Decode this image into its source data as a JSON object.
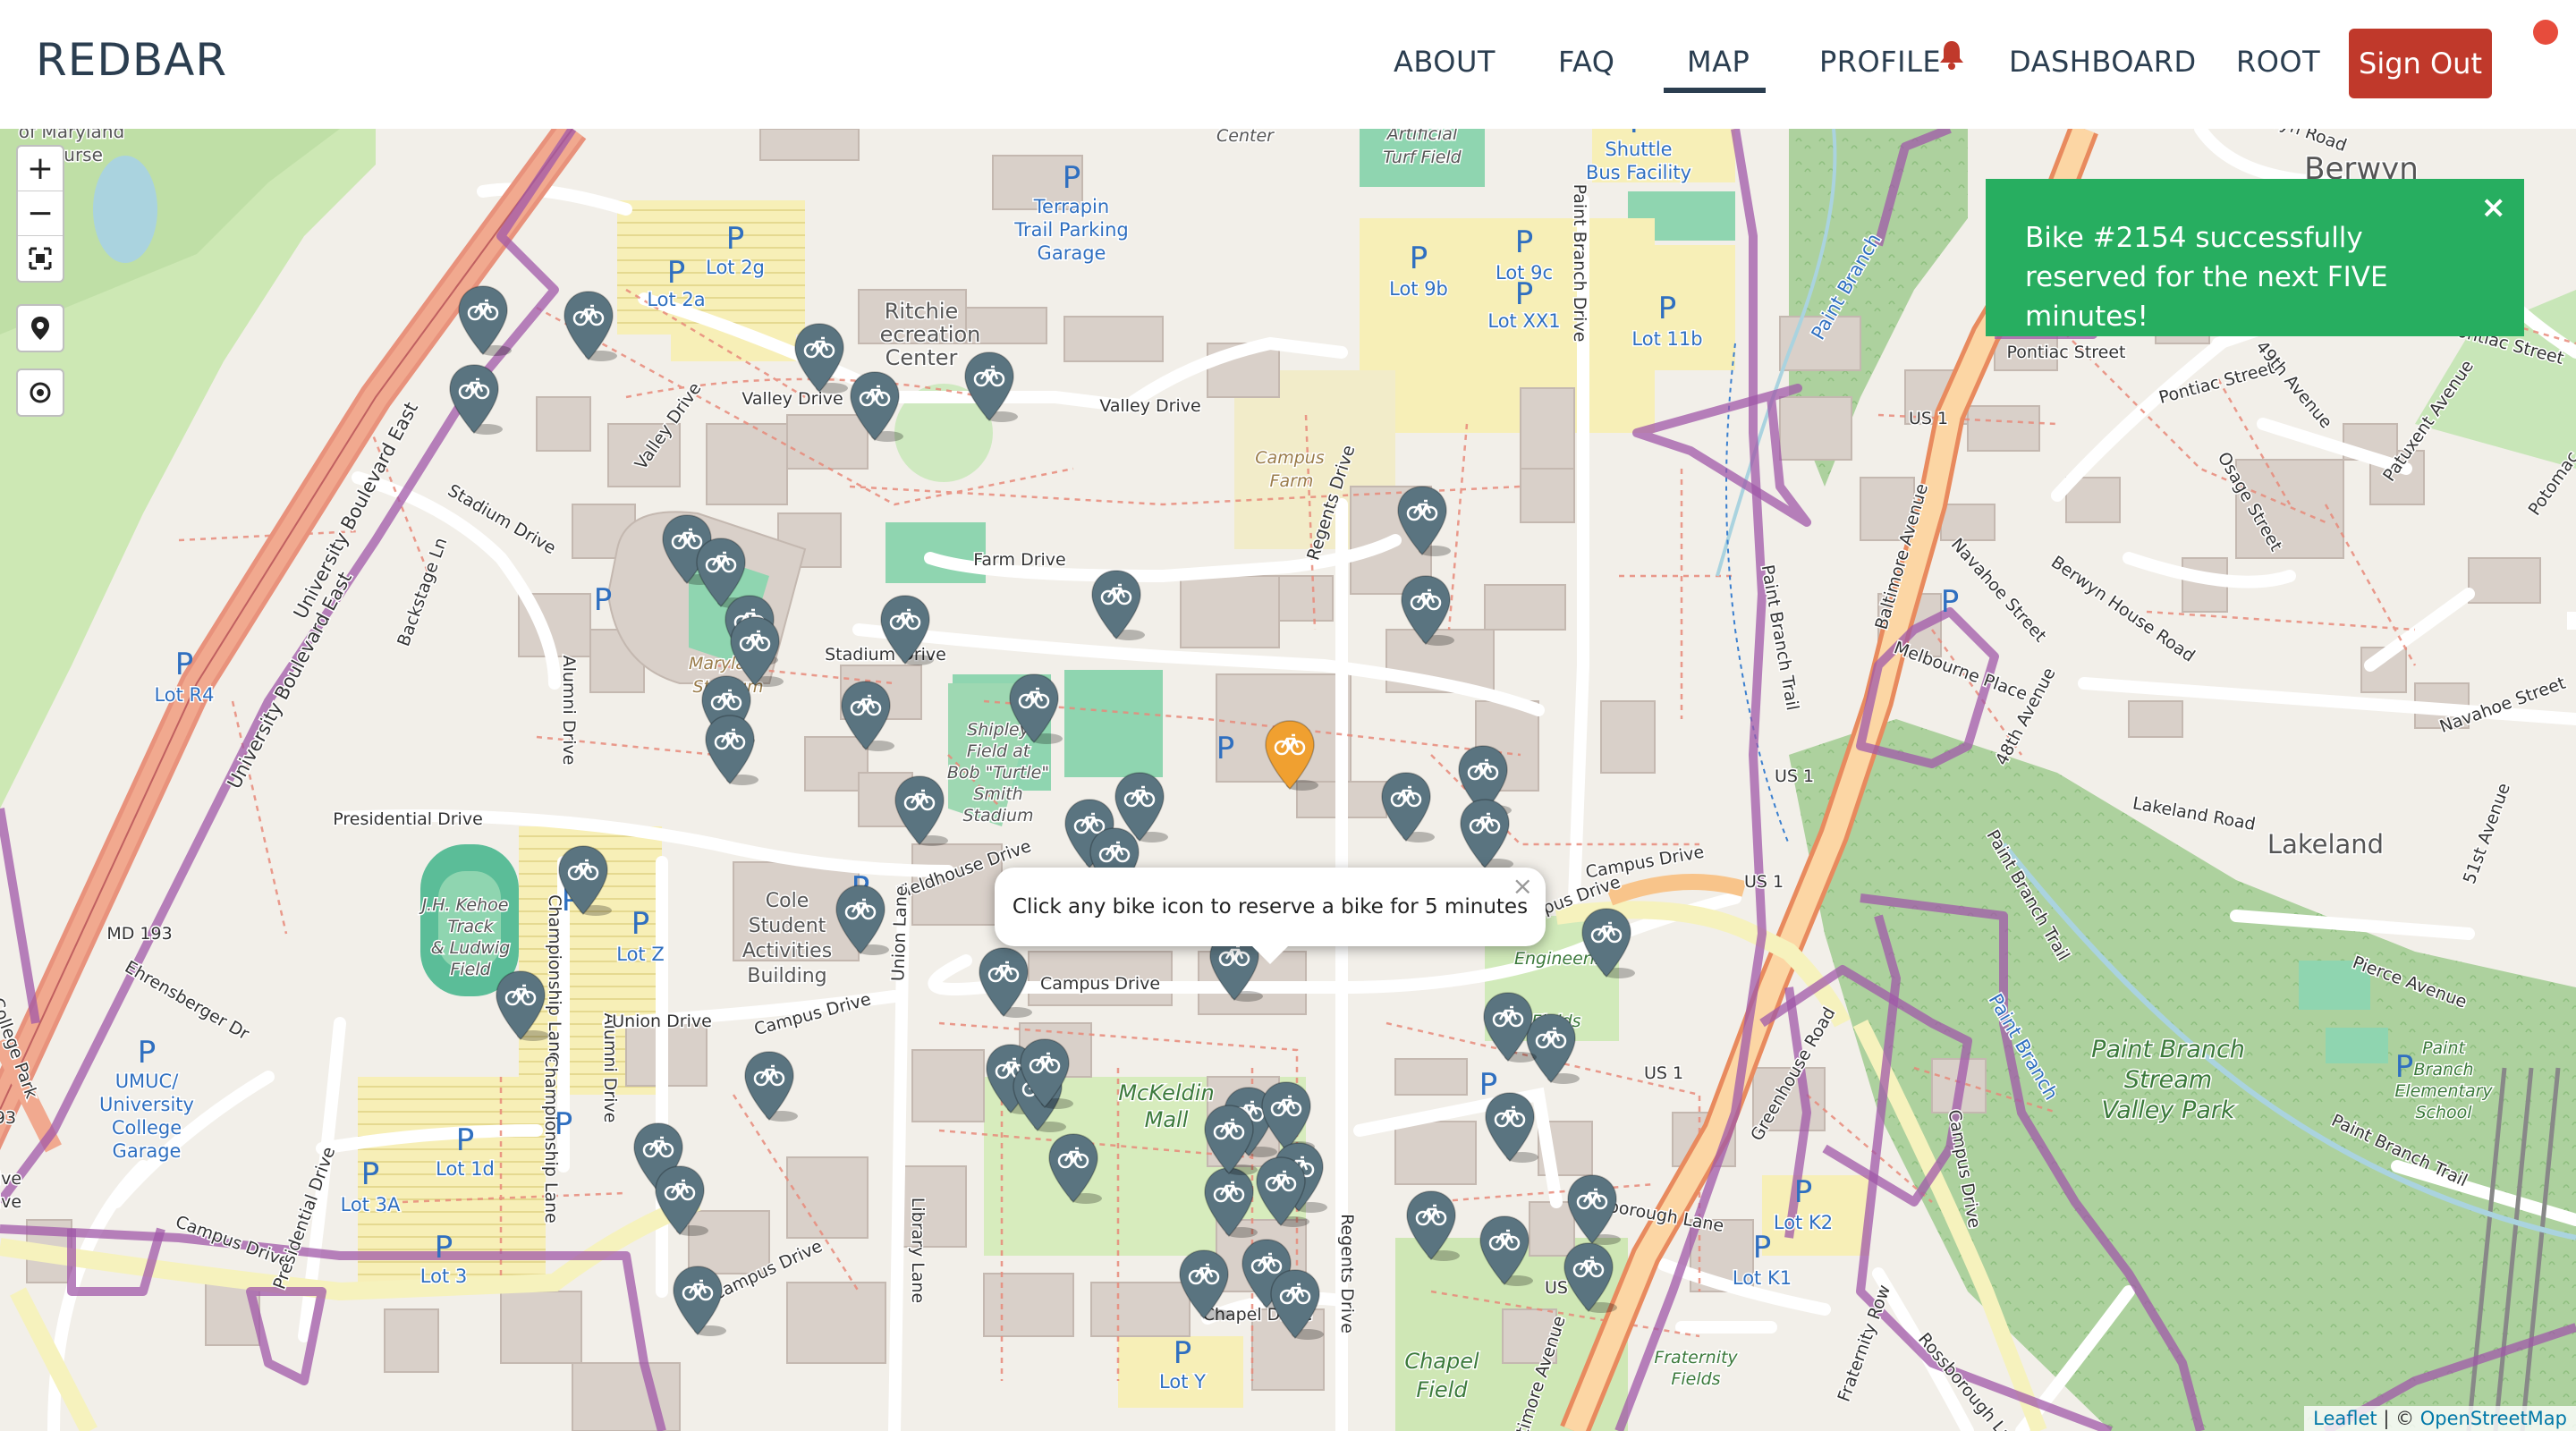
{
  "brand": "REDBAR",
  "nav": {
    "about": "ABOUT",
    "faq": "FAQ",
    "map": "MAP",
    "profile": "PROFILE",
    "dashboard": "DASHBOARD",
    "root": "ROOT",
    "sign_out": "Sign Out",
    "active": "MAP"
  },
  "colors": {
    "brand_text": "#2b3e50",
    "sign_out_bg": "#c0392b",
    "toast_bg": "#27ae60",
    "bike_marker": "#5a7480",
    "selected_marker": "#f0a030",
    "boundary": "#a058a8"
  },
  "map": {
    "controls": {
      "zoom_in": "+",
      "zoom_out": "−",
      "fullscreen_icon": "fullscreen-icon",
      "locate_icon": "map-pin-icon",
      "target_icon": "target-icon"
    },
    "toast": {
      "message": "Bike #2154 successfully reserved for the next FIVE minutes!",
      "close": "×"
    },
    "popup": {
      "message": "Click any bike icon to reserve a bike for 5 minutes",
      "close": "×"
    },
    "attribution": {
      "leaflet": "Leaflet",
      "separator": " | © ",
      "osm": "OpenStreetMap"
    },
    "labels": {
      "terrapin": "Terrapin",
      "trail_parking": "Trail Parking",
      "garage": "Garage",
      "center": "Center",
      "artificial": "Artificial",
      "turf_field": "Turf Field",
      "shuttle": "Shuttle",
      "bus_facility": "Bus Facility",
      "lot_2g": "Lot 2g",
      "lot_2a": "Lot 2a",
      "lot_9b": "Lot 9b",
      "lot_9c": "Lot 9c",
      "lot_xx1": "Lot XX1",
      "lot_11b": "Lot 11b",
      "ritchie": "Ritchie",
      "recreation": "ecreation",
      "center2": "Center",
      "valley_drive": "Valley Drive",
      "valley_drive2": "Valley Drive",
      "campus_farm": "Campus",
      "farm": "Farm",
      "farm_drive": "Farm Drive",
      "stadium_drive": "Stadium Drive",
      "stadium_drive2": "Stadium Drive",
      "regents_drive": "Regents Drive",
      "regents_drive2": "Regents Drive",
      "paint_branch_drive": "Paint Branch Drive",
      "univ_blvd_east": "University Boulevard East",
      "univ_blvd_east2": "University Boulevard East",
      "backstage_ln": "Backstage Ln",
      "lot_r4": "Lot R4",
      "alumni_drive": "Alumni Drive",
      "alumni_drive2": "Alumni Drive",
      "maryland_stadium": "Maryland",
      "stadium": "Stadium",
      "shipley": "Shipley",
      "field_at": "Field at",
      "bob_turtle": "Bob \"Turtle\"",
      "smith": "Smith",
      "stadium2": "Stadium",
      "presidential_drive": "Presidential Drive",
      "presidential_drive2": "Presidential Drive",
      "fieldhouse_drive": "Fieldhouse Drive",
      "jh_kehoe": "J.H. Kehoe",
      "track": "Track",
      "ludwig": "& Ludwig",
      "field": "Field",
      "championship_lane": "Championship Lane",
      "championship_lane2": "Championship Lane",
      "lot_z": "Lot Z",
      "cole": "Cole",
      "student": "Student",
      "activities": "Activities",
      "building": "Building",
      "union_lane": "Union Lane",
      "union_drive": "Union Drive",
      "campus_drive": "Campus Drive",
      "campus_drive2": "Campus Drive",
      "campus_drive3": "Campus Drive",
      "campus_drive4": "Campus Drive",
      "campus_drive5": "Campus Drive",
      "campus_drive6": "Campus Drive",
      "campus_drive7": "Campus Drive",
      "md_193": "MD 193",
      "ehrensberger": "Ehrensberger Dr",
      "umuc": "UMUC/",
      "university": "University",
      "college": "College",
      "garage2": "Garage",
      "lot_1d": "Lot 1d",
      "lot_3a": "Lot 3A",
      "lot_3": "Lot 3",
      "mckeldin": "McKeldin",
      "mall": "Mall",
      "library_lane": "Library Lane",
      "chapel_drive": "Chapel Drive",
      "chapel": "Chapel",
      "field2": "Field",
      "lot_y": "Lot Y",
      "engineering": "Engineering",
      "fields": "Fields",
      "fraternity": "Fraternity",
      "fields2": "Fields",
      "fraternity_row": "Fraternity Row",
      "lot_k2": "Lot K2",
      "lot_k1": "Lot K1",
      "rossborough_lane": "Rossborough Lane",
      "rossborough_lane2": "Rossborough Lane",
      "greenhouse_road": "Greenhouse Road",
      "us1": "US 1",
      "us1b": "US 1",
      "us1c": "US 1",
      "us1d": "US 1",
      "us1e": "US 1",
      "us1f": "US",
      "baltimore_avenue": "Baltimore Avenue",
      "baltimore_avenue2": "Baltimore Avenue",
      "navahoe_street": "Navahoe Street",
      "navahoe_street2": "Navahoe Street",
      "melbourne_place": "Melbourne Place",
      "berwyn_house_road": "Berwyn House Road",
      "berwyn_road": "Berwyn Road",
      "berwyn": "Berwyn",
      "pontiac_street": "Pontiac Street",
      "pontiac_street2": "Pontiac Street",
      "pontiac_street3": "Pontiac Street",
      "osage_street": "Osage Street",
      "ave_49th": "49th Avenue",
      "ave_48th": "48th Avenue",
      "patuxent_avenue": "Patuxent Avenue",
      "potomac": "Potomac",
      "lakeland": "Lakeland",
      "lakeland_road": "Lakeland Road",
      "ave_51st": "51st Avenue",
      "pierce_avenue": "Pierce Avenue",
      "paint_branch_trail": "Paint Branch Trail",
      "paint_branch_trail2": "Paint Branch Trail",
      "paint_branch_trail3": "Paint Branch Trail",
      "paint_branch": "Paint Branch",
      "paint_branch2": "Paint Branch",
      "paint_branch_park1": "Paint Branch",
      "paint_branch_park2": "Stream",
      "paint_branch_park3": "Valley Park",
      "pb_elem1": "Paint",
      "pb_elem2": "Branch",
      "pb_elem3": "Elementary",
      "pb_elem4": "School",
      "of_maryland": "of Maryland",
      "course": "Course",
      "college_park": "College Park",
      "drive_93": "93",
      "ive": "ive",
      "ive2": "ive",
      "adelphi": "Adelph",
      "baltimore_avenue3": "Baltimore Avenue"
    },
    "bike_count": 63
  }
}
